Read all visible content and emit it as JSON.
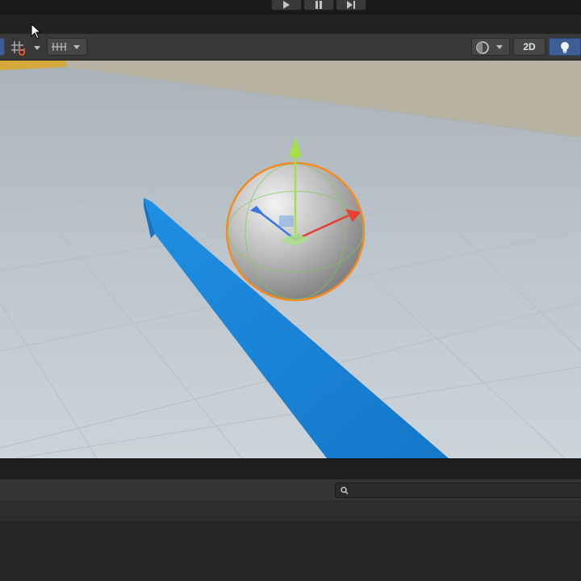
{
  "play_controls": {
    "items": [
      "play-icon",
      "pause-icon",
      "step-icon"
    ]
  },
  "scene_toolbar": {
    "snap_icon": "grid-snap-icon",
    "increment_snap_icon": "increment-snap-icon",
    "render_mode_icon": "render-mode-sphere-icon",
    "toggle_2d_label": "2D",
    "lighting_icon": "lightbulb-icon"
  },
  "scene": {
    "selected_object": "Sphere",
    "gizmo": "move",
    "axis_colors": {
      "x": "#e8402f",
      "y": "#a5e04a",
      "z": "#3b76e0"
    },
    "selection_outline": "#f58a1f",
    "wall_color": "#1c86d9",
    "floor_color": "#c4ccd2"
  },
  "bottom_panel": {
    "search": {
      "value": "",
      "placeholder": ""
    },
    "search_icon": "search-icon"
  }
}
